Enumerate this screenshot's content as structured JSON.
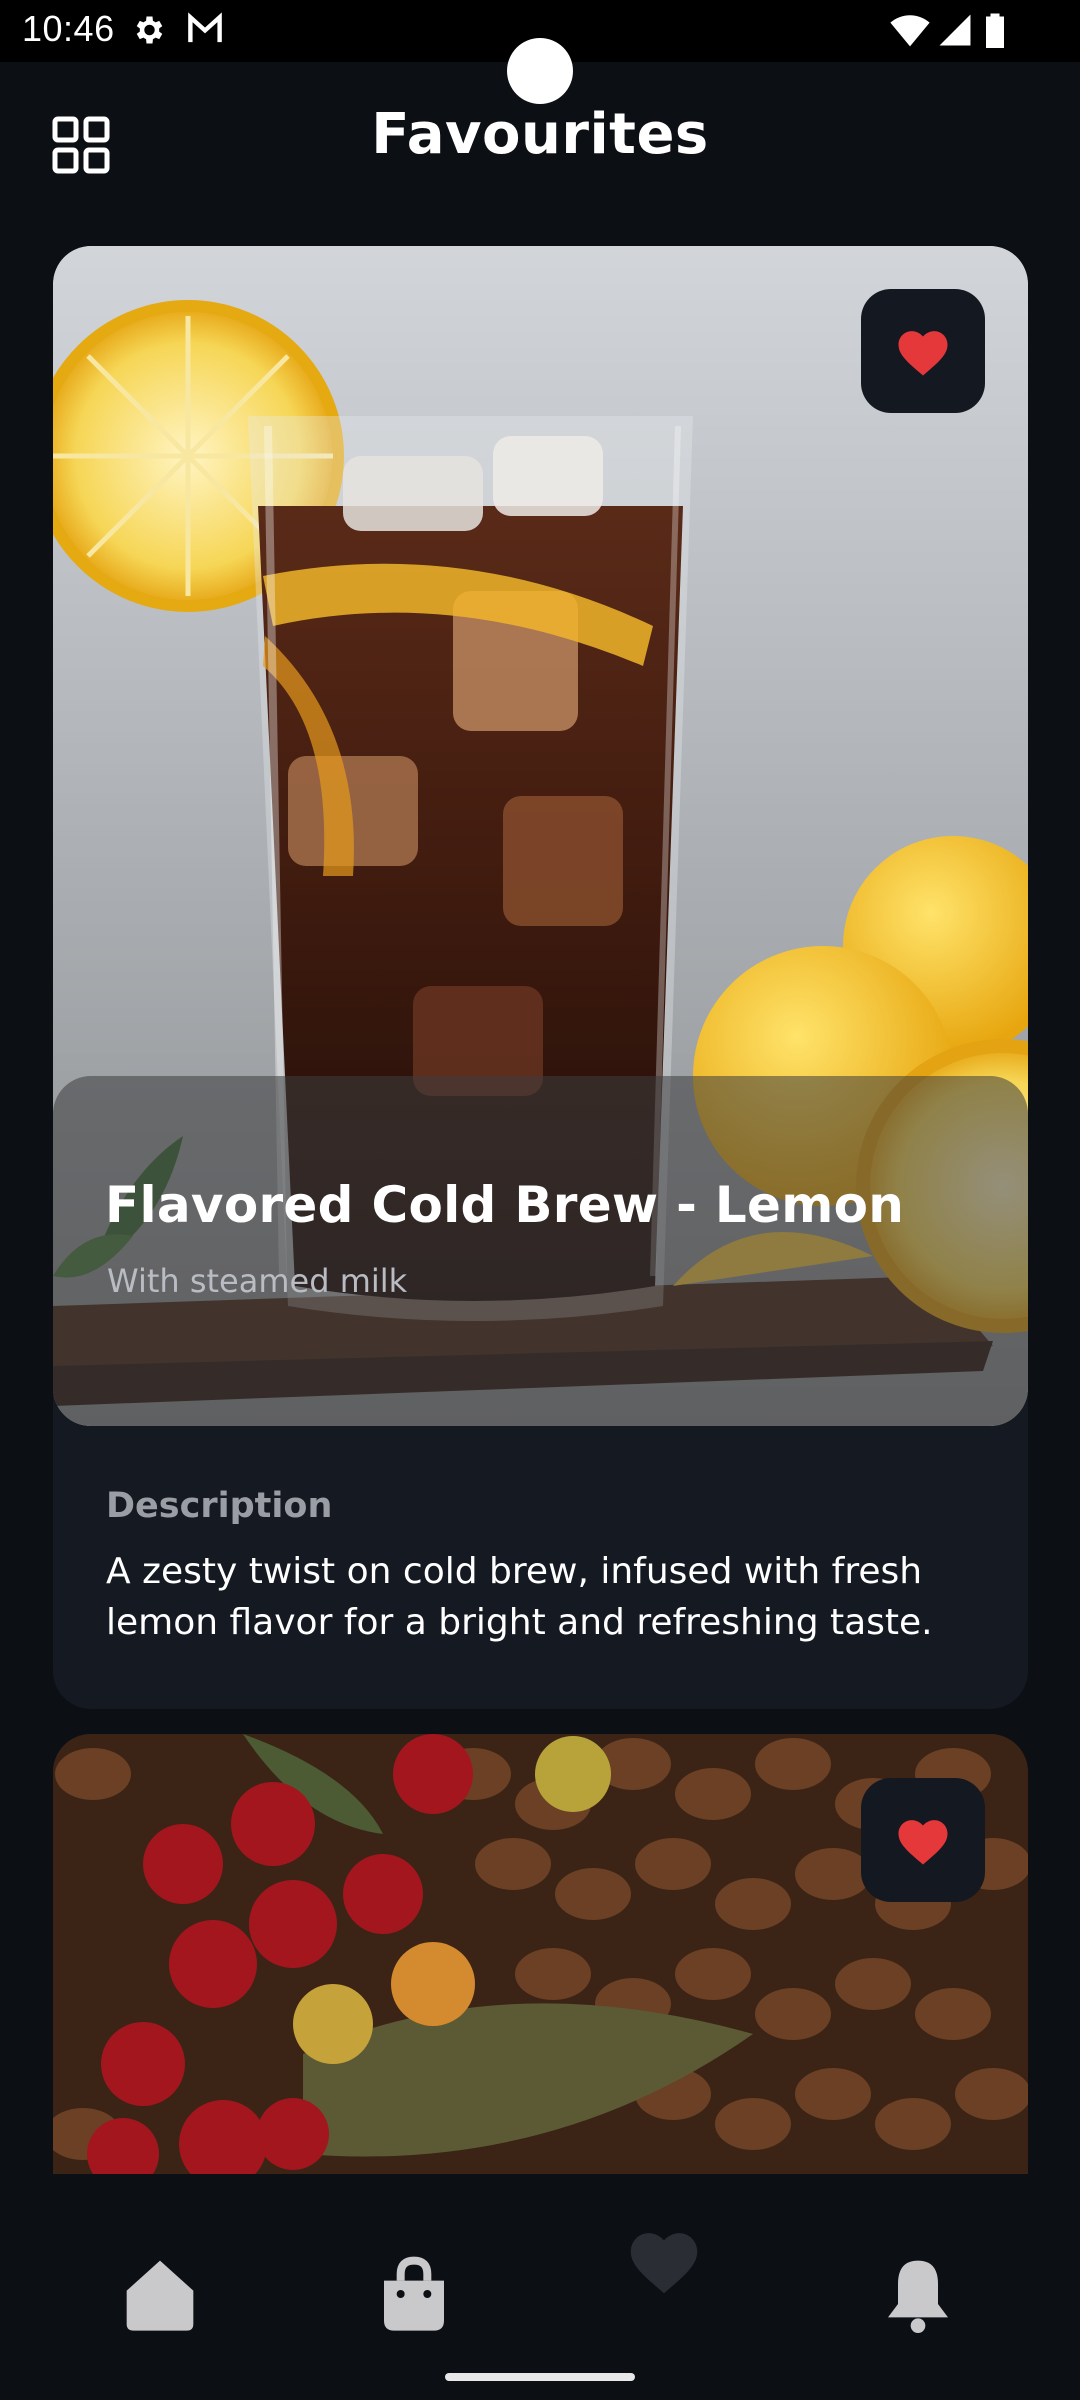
{
  "status_bar": {
    "time": "10:46",
    "left_icons": [
      "gear-icon",
      "gmail-icon"
    ],
    "right_icons": [
      "wifi-icon",
      "signal-icon",
      "battery-icon"
    ]
  },
  "header": {
    "title": "Favourites",
    "menu_icon": "grid-icon"
  },
  "favourites": [
    {
      "name": "Flavored Cold Brew - Lemon",
      "subtitle": "With steamed milk",
      "favorited": true,
      "image": "iced cold brew with lemon slices",
      "description_label": "Description",
      "description": "A zesty twist on cold brew, infused with fresh lemon flavor for a bright and refreshing taste."
    },
    {
      "favorited": true,
      "image": "coffee cherries and roasted coffee beans"
    }
  ],
  "bottom_nav": {
    "items": [
      {
        "icon": "home-icon",
        "active": false
      },
      {
        "icon": "shopping-bag-icon",
        "active": false
      },
      {
        "icon": "heart-icon",
        "active": true
      },
      {
        "icon": "bell-icon",
        "active": false
      }
    ]
  },
  "colors": {
    "background": "#0c0f14",
    "card": "#151922",
    "heart": "#e5383b",
    "nav_icon": "#c9c9cc"
  }
}
